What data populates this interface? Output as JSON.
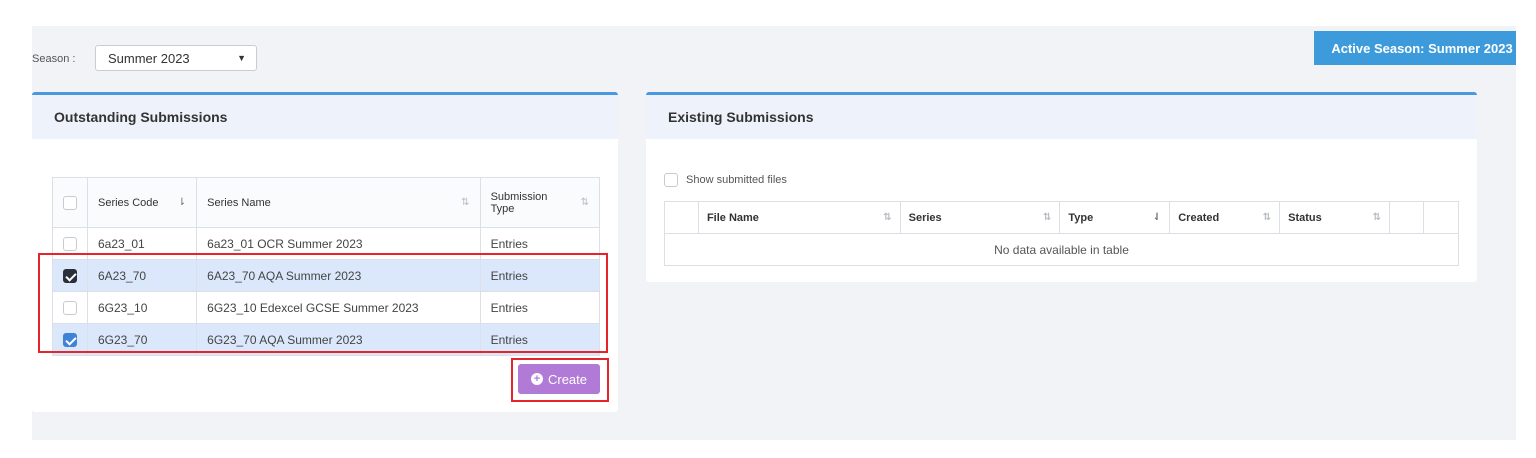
{
  "season": {
    "label": "Season :",
    "selected": "Summer 2023"
  },
  "active_season": "Active Season: Summer 2023",
  "outstanding": {
    "title": "Outstanding Submissions",
    "columns": {
      "code": "Series Code",
      "name": "Series Name",
      "type": "Submission Type"
    },
    "rows": [
      {
        "code": "6a23_01",
        "name": "6a23_01 OCR Summer 2023",
        "type": "Entries"
      },
      {
        "code": "6A23_70",
        "name": "6A23_70 AQA Summer 2023",
        "type": "Entries"
      },
      {
        "code": "6G23_10",
        "name": "6G23_10 Edexcel GCSE Summer 2023",
        "type": "Entries"
      },
      {
        "code": "6G23_70",
        "name": "6G23_70 AQA Summer 2023",
        "type": "Entries"
      }
    ],
    "create_label": "Create"
  },
  "existing": {
    "title": "Existing Submissions",
    "show_files_label": "Show submitted files",
    "columns": {
      "file": "File Name",
      "series": "Series",
      "type": "Type",
      "created": "Created",
      "status": "Status"
    },
    "empty_text": "No data available in table"
  },
  "colors": {
    "accent": "#3d9bdc",
    "create": "#b17ad6",
    "highlight": "#e5252a",
    "selected_row": "#dbe8fb"
  }
}
